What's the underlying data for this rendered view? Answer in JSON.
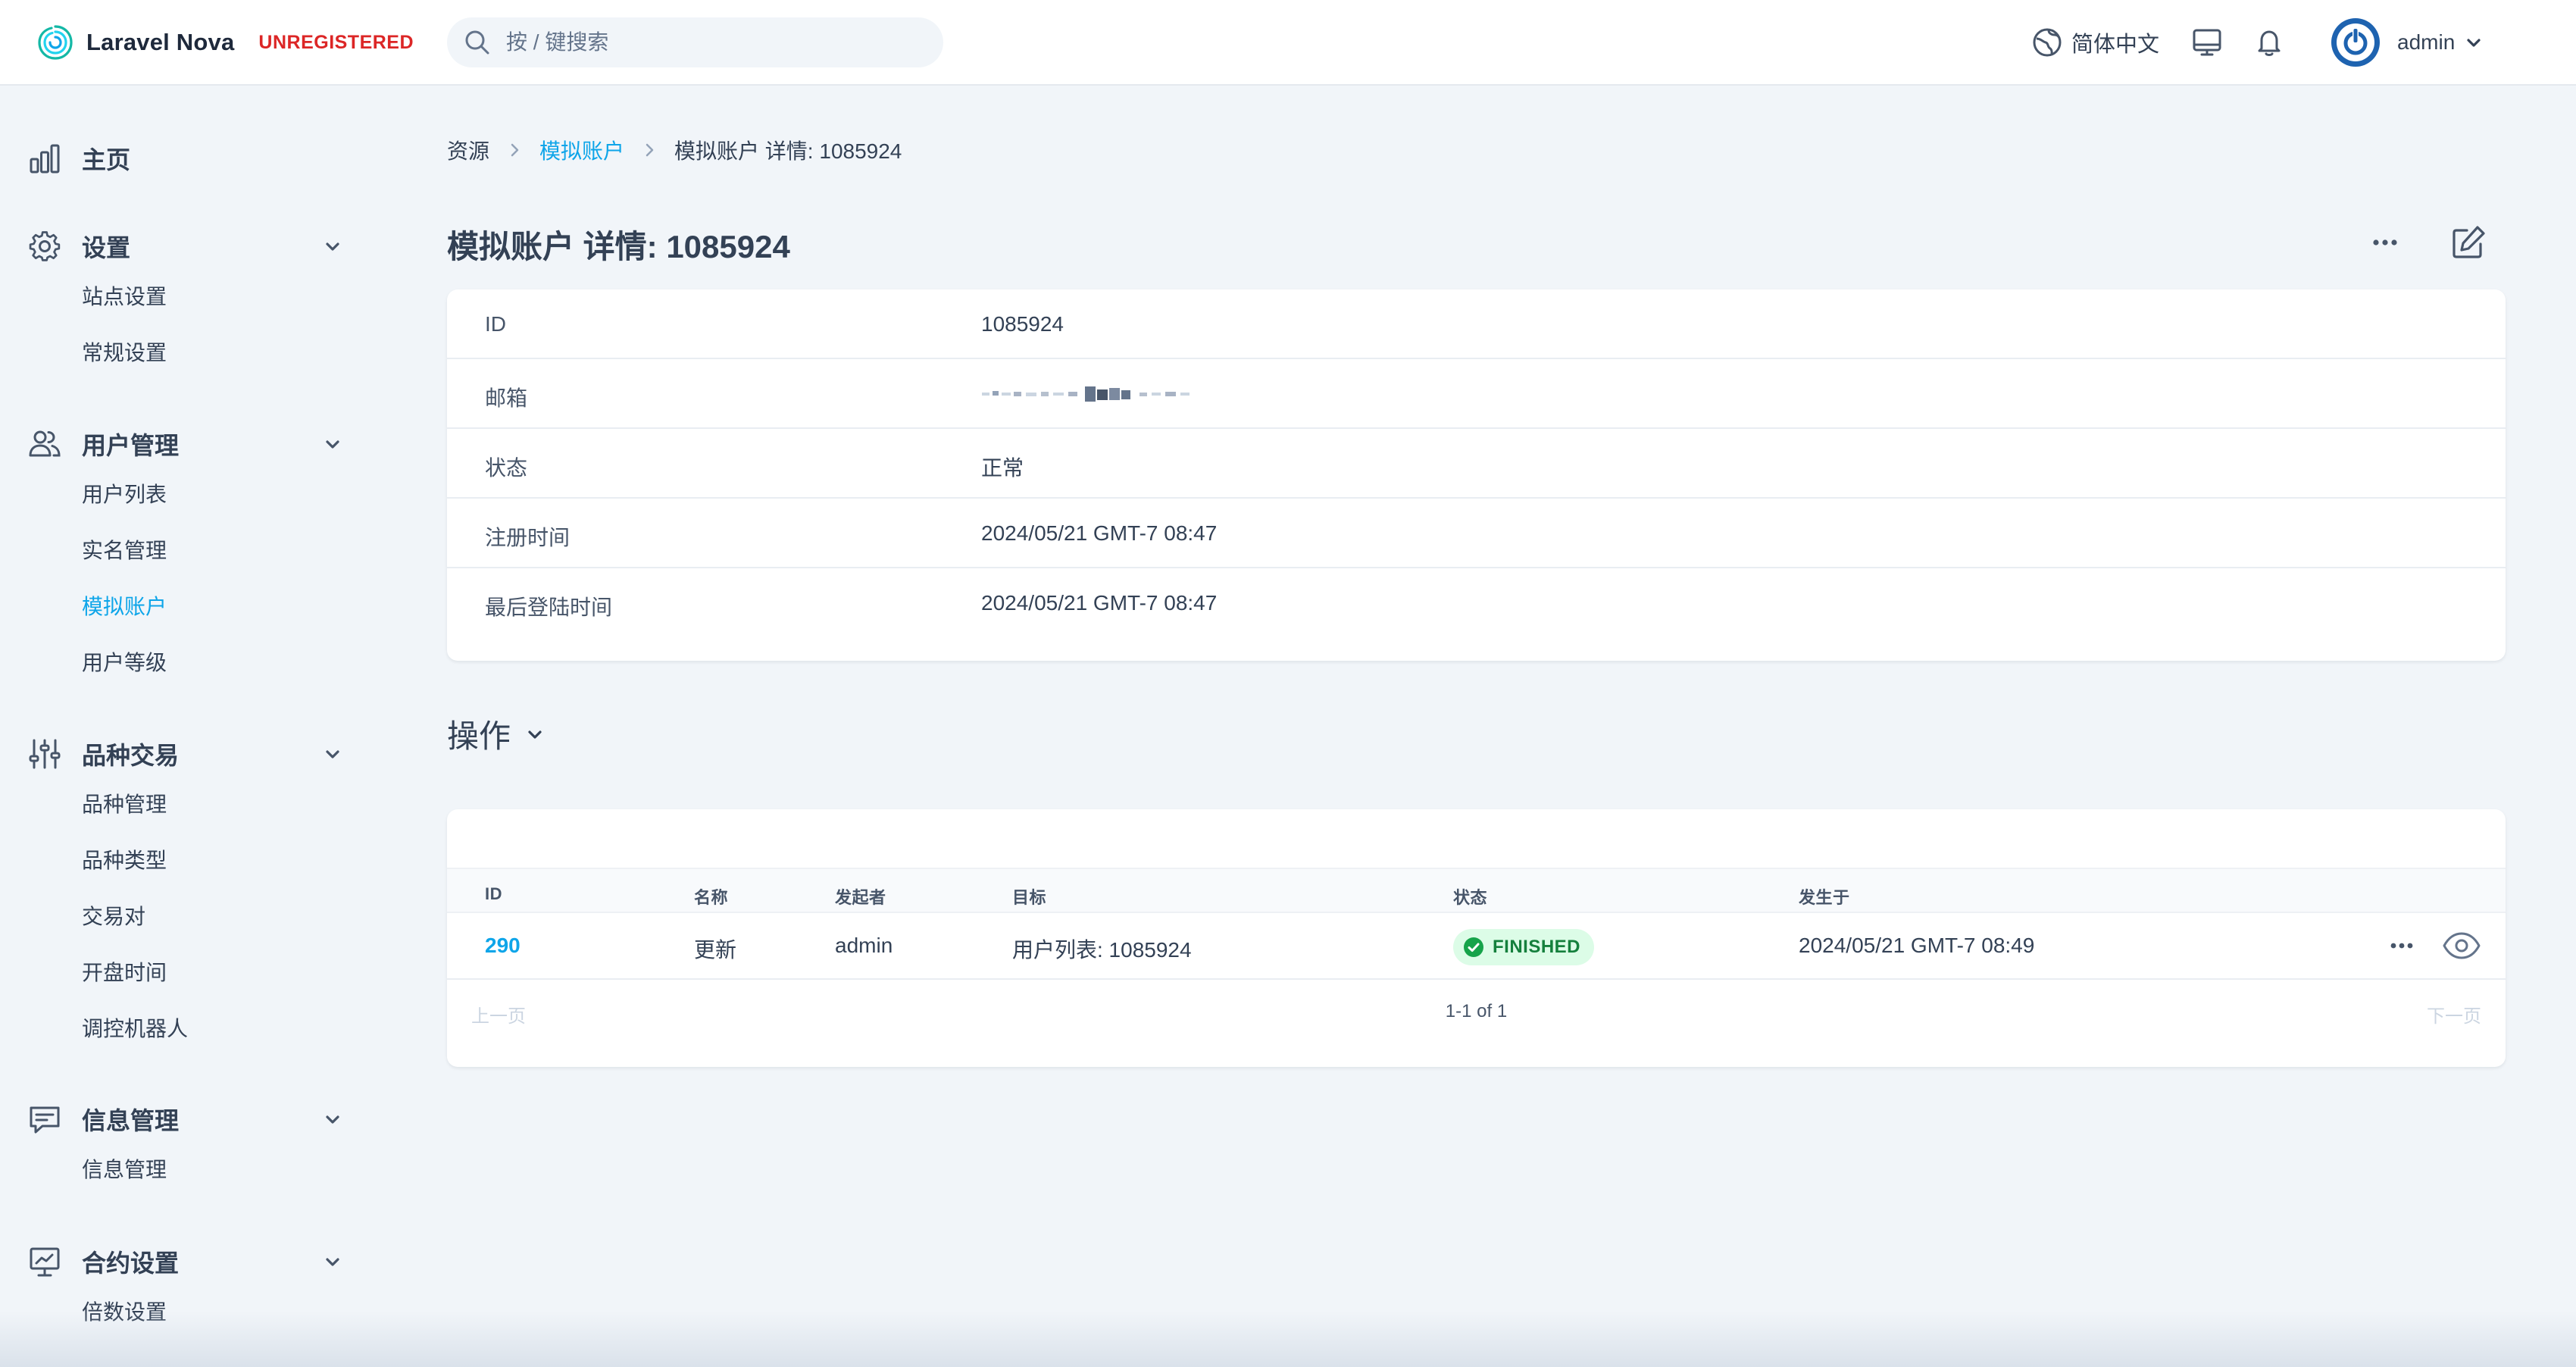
{
  "colors": {
    "accent": "#0ea5e9",
    "unregistered": "#dc2626",
    "success_bg": "#dcfce7",
    "success_text": "#15803d",
    "background": "#f1f5f9"
  },
  "header": {
    "brand_name": "Laravel Nova",
    "brand_badge": "UNREGISTERED",
    "search_placeholder": "按 / 键搜索",
    "language": "简体中文",
    "user_name": "admin",
    "icons": [
      "search-icon",
      "globe-icon",
      "monitor-icon",
      "bell-icon",
      "power-avatar-icon",
      "chevron-down-icon"
    ]
  },
  "sidebar": {
    "home": "主页",
    "groups": [
      {
        "label": "设置",
        "icon": "gear-icon",
        "items": [
          "站点设置",
          "常规设置"
        ]
      },
      {
        "label": "用户管理",
        "icon": "users-icon",
        "items": [
          "用户列表",
          "实名管理",
          "模拟账户",
          "用户等级"
        ]
      },
      {
        "label": "品种交易",
        "icon": "sliders-icon",
        "items": [
          "品种管理",
          "品种类型",
          "交易对",
          "开盘时间",
          "调控机器人"
        ]
      },
      {
        "label": "信息管理",
        "icon": "chat-icon",
        "items": [
          "信息管理"
        ]
      },
      {
        "label": "合约设置",
        "icon": "presentation-icon",
        "items": [
          "倍数设置"
        ]
      }
    ],
    "active_item": "模拟账户"
  },
  "breadcrumb": [
    "资源",
    "模拟账户",
    "模拟账户 详情: 1085924"
  ],
  "page_title": "模拟账户 详情: 1085924",
  "details": [
    {
      "key": "ID",
      "value": "1085924"
    },
    {
      "key": "邮箱",
      "value": ""
    },
    {
      "key": "状态",
      "value": "正常"
    },
    {
      "key": "注册时间",
      "value": "2024/05/21 GMT-7 08:47"
    },
    {
      "key": "最后登陆时间",
      "value": "2024/05/21 GMT-7 08:47"
    }
  ],
  "actions_section": {
    "title": "操作",
    "columns": [
      "ID",
      "名称",
      "发起者",
      "目标",
      "状态",
      "发生于"
    ],
    "rows": [
      {
        "id": "290",
        "name": "更新",
        "initiator": "admin",
        "target": "用户列表: 1085924",
        "status": "FINISHED",
        "occurred_at": "2024/05/21 GMT-7 08:49"
      }
    ],
    "pagination": {
      "prev": "上一页",
      "info": "1-1 of 1",
      "next": "下一页"
    }
  }
}
